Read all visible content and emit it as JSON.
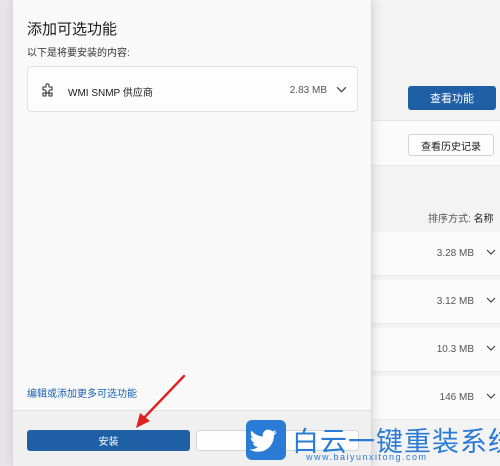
{
  "background": {
    "view_features_button": "查看功能",
    "view_history_button": "查看历史记录",
    "sort_label": "排序方式:",
    "sort_value": "名称",
    "sizes": [
      "3.28 MB",
      "3.12 MB",
      "10.3 MB",
      "146 MB"
    ]
  },
  "dialog": {
    "title": "添加可选功能",
    "subtitle": "以下是将要安装的内容:",
    "feature": {
      "name": "WMI SNMP 供应商",
      "size": "2.83 MB",
      "icon": "puzzle-icon"
    },
    "more_link": "编辑或添加更多可选功能",
    "install_button": "安装",
    "cancel_button": ""
  },
  "watermark": {
    "text": "白云一键重装系统",
    "url": "www.baiyunxitong.com",
    "color": "#2a7bd5"
  },
  "colors": {
    "accent": "#1f5fa6",
    "arrow": "#e02020"
  }
}
